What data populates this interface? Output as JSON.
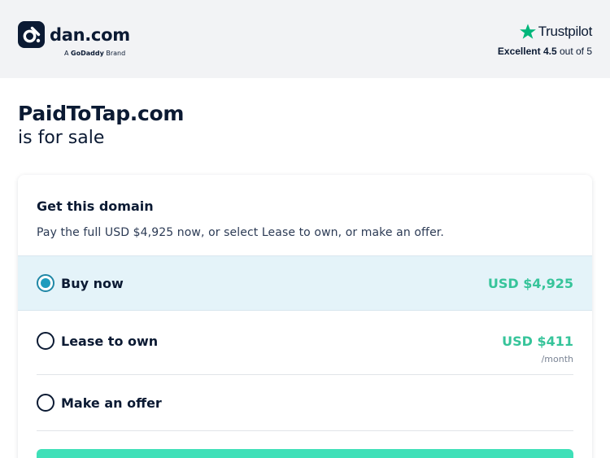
{
  "header": {
    "logo_text": "dan.com",
    "logo_sub_prefix": "A",
    "logo_sub_brand": "GoDaddy",
    "logo_sub_suffix": "Brand",
    "trustpilot_name": "Trustpilot",
    "trustpilot_label": "Excellent",
    "trustpilot_score": "4.5",
    "trustpilot_suffix": "out of 5"
  },
  "domain": {
    "name": "PaidToTap.com",
    "status": "is for sale"
  },
  "card": {
    "heading": "Get this domain",
    "description": "Pay the full USD $4,925 now, or select Lease to own, or make an offer.",
    "options": [
      {
        "label": "Buy now",
        "price": "USD $4,925",
        "unit": "",
        "selected": true
      },
      {
        "label": "Lease to own",
        "price": "USD $411",
        "unit": "/month",
        "selected": false
      },
      {
        "label": "Make an offer",
        "price": "",
        "unit": "",
        "selected": false
      }
    ]
  },
  "colors": {
    "navy": "#0b1a33",
    "header_bg": "#f2f3f5",
    "selected_bg": "#e4f3f9",
    "price_green": "#36c49a",
    "cta_green": "#3fe0b8",
    "trustpilot_green": "#00b67a"
  },
  "icons": {
    "logo": "dan-logo-icon",
    "trustpilot": "star-icon"
  }
}
